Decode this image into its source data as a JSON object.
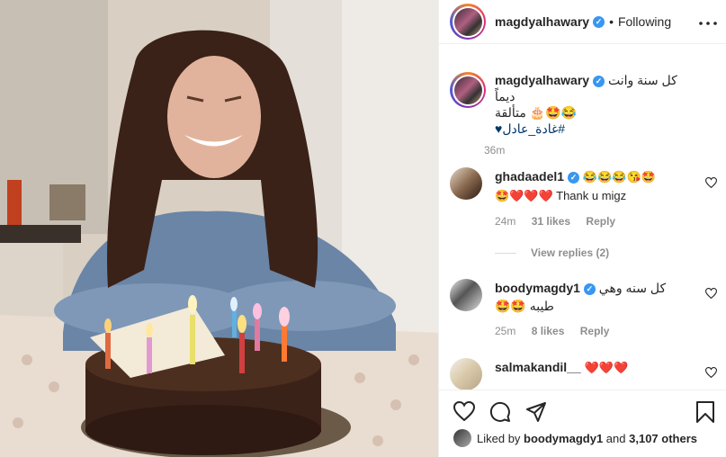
{
  "post": {
    "author": "magdyalhawary",
    "follow_state": "Following",
    "separator": "•",
    "caption_line1": "كل سنة وانت ديماً",
    "caption_line2": "😂🤩🎂 متألقة",
    "caption_hashtag": "#غادة_عادل♥",
    "time": "36m"
  },
  "comments": [
    {
      "user": "ghadaadel1",
      "line1": "😂😂😂😘🤩",
      "line2": "🤩❤️❤️❤️ Thank u migz",
      "time": "24m",
      "likes": "31 likes",
      "reply": "Reply"
    },
    {
      "user": "boodymagdy1",
      "line1": "كل سنه وهي",
      "line2": "طيبه 🤩🤩",
      "time": "25m",
      "likes": "8 likes",
      "reply": "Reply"
    },
    {
      "user": "salmakandil__",
      "line1": "❤️❤️❤️",
      "line2": "",
      "time": "",
      "likes": "",
      "reply": ""
    }
  ],
  "view_replies": "View replies (2)",
  "likes_bar": {
    "prefix": "Liked by",
    "user": "boodymagdy1",
    "suffix": "and",
    "count": "3,107 others"
  },
  "icons": [
    "more-icon",
    "heart-icon",
    "comment-icon",
    "share-icon",
    "bookmark-icon",
    "verified-icon"
  ]
}
